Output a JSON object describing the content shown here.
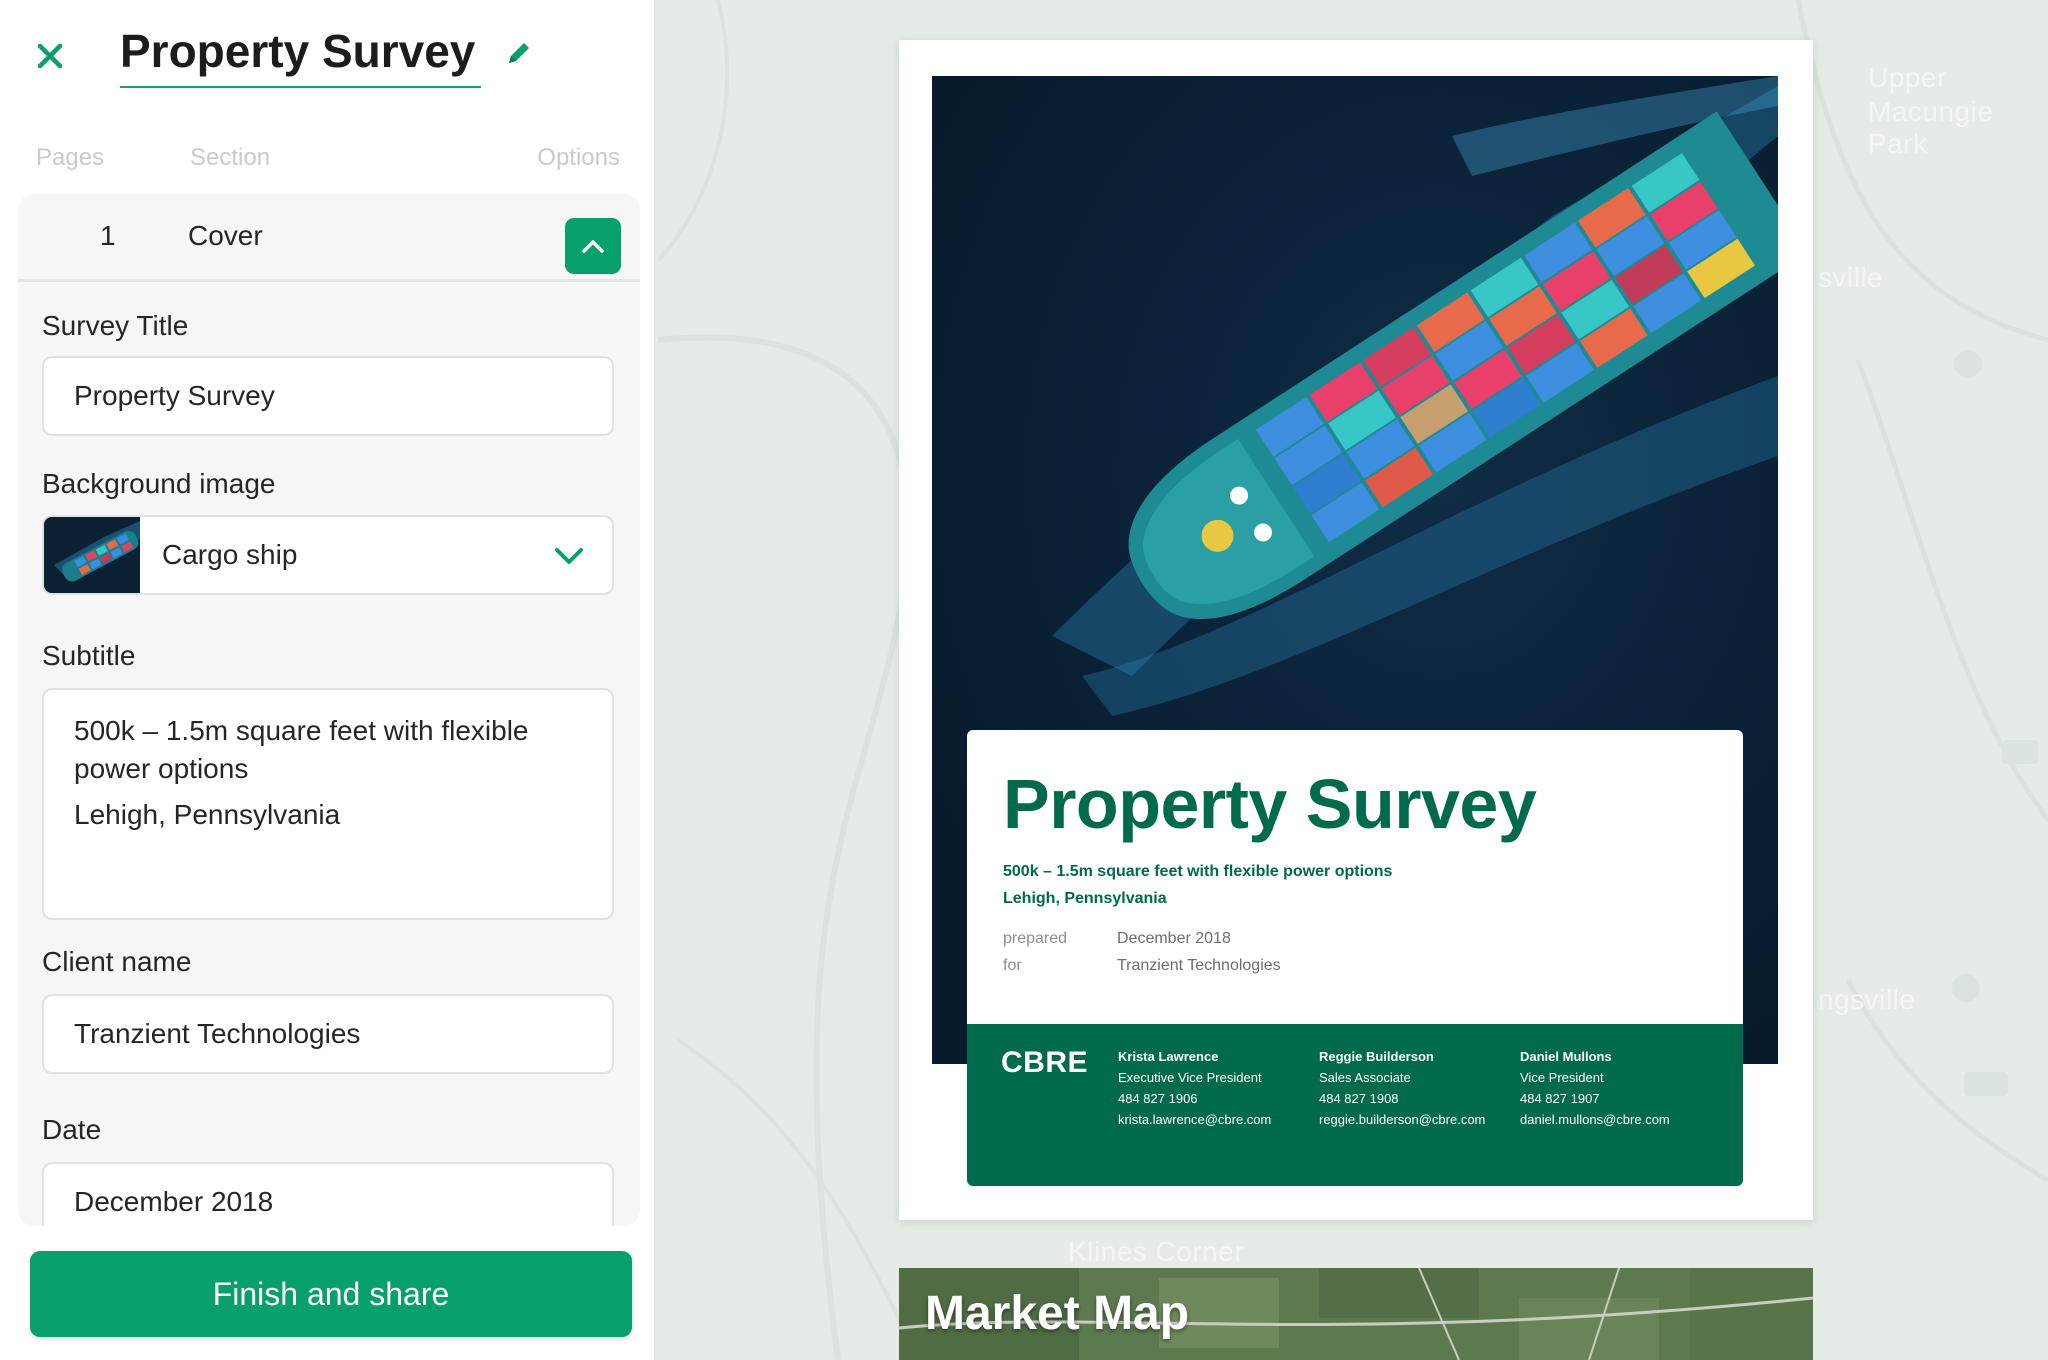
{
  "editor": {
    "doc_title": "Property Survey",
    "columns": {
      "pages": "Pages",
      "section": "Section",
      "options": "Options"
    },
    "section": {
      "page_number": "1",
      "name": "Cover"
    },
    "fields": {
      "survey_title_label": "Survey Title",
      "survey_title_value": "Property Survey",
      "background_label": "Background image",
      "background_value": "Cargo ship",
      "subtitle_label": "Subtitle",
      "subtitle_line1": "500k – 1.5m square feet with flexible power options",
      "subtitle_line2": "Lehigh, Pennsylvania",
      "client_label": "Client name",
      "client_value": "Tranzient Technologies",
      "date_label": "Date",
      "date_value": "December 2018"
    },
    "finish_label": "Finish and share"
  },
  "map": {
    "labels": [
      "Upper",
      "Macungie Park",
      "sville",
      "ngsville",
      "Klines Corner"
    ]
  },
  "preview": {
    "title": "Property Survey",
    "subtitle_line1": "500k – 1.5m square feet with flexible power options",
    "subtitle_line2": "Lehigh, Pennsylvania",
    "prepared_label": "prepared",
    "for_label": "for",
    "date": "December 2018",
    "client": "Tranzient Technologies",
    "logo": "CBRE",
    "contacts": [
      {
        "name": "Krista Lawrence",
        "title": "Executive Vice President",
        "phone": "484 827 1906",
        "email": "krista.lawrence@cbre.com"
      },
      {
        "name": "Reggie Builderson",
        "title": "Sales Associate",
        "phone": "484 827 1908",
        "email": "reggie.builderson@cbre.com"
      },
      {
        "name": "Daniel Mullons",
        "title": "Vice President",
        "phone": "484 827 1907",
        "email": "daniel.mullons@cbre.com"
      }
    ],
    "next_page_title": "Market Map"
  },
  "colors": {
    "accent": "#07a06d",
    "brand_green": "#006a4d",
    "panel_bg": "#f5f6f5",
    "map_bg": "#e5ece6"
  },
  "icons": [
    "close-icon",
    "pencil-icon",
    "chevron-up-icon",
    "chevron-down-icon"
  ]
}
